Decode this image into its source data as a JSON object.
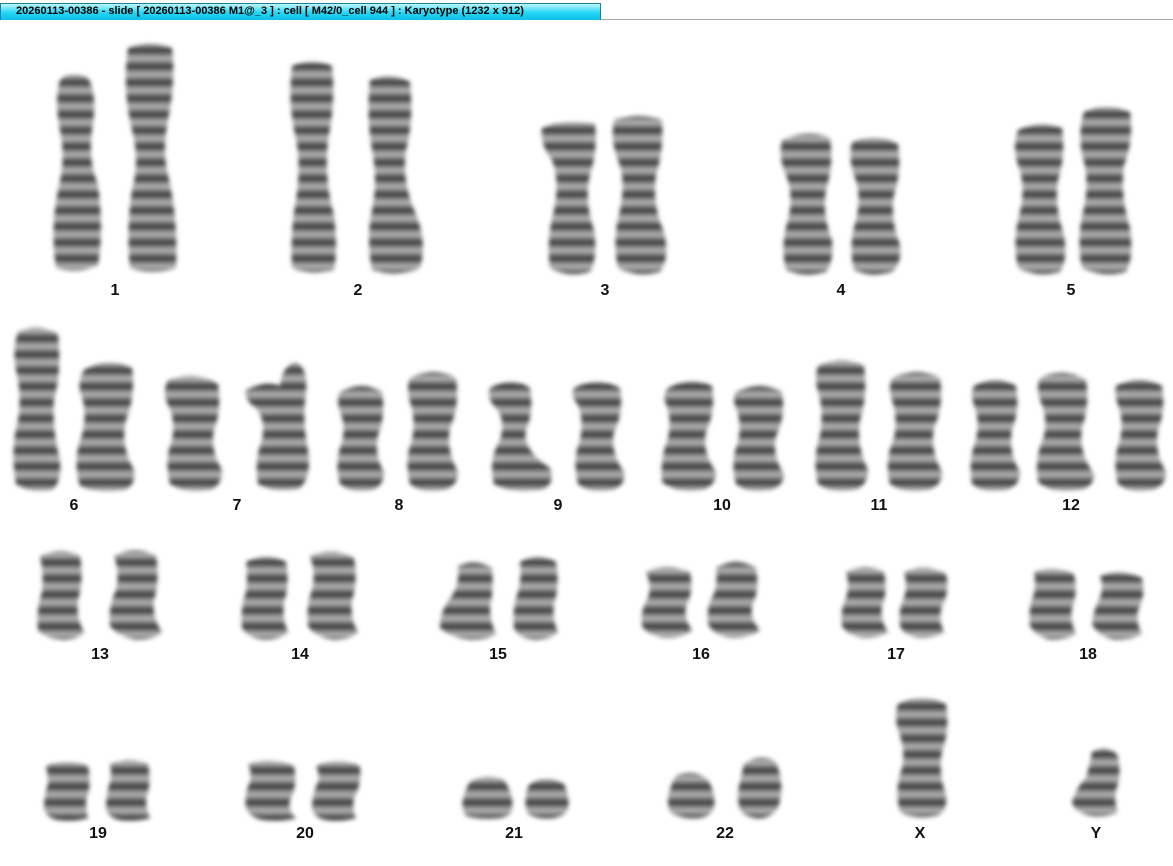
{
  "window": {
    "title": "20260113-00386 - slide [ 20260113-00386 M1@_3 ] : cell [ M42/0_cell 944 ] : Karyotype  (1232 x 912)"
  },
  "karyotype": {
    "labels": [
      "1",
      "2",
      "3",
      "4",
      "5",
      "6",
      "7",
      "8",
      "9",
      "10",
      "11",
      "12",
      "13",
      "14",
      "15",
      "16",
      "17",
      "18",
      "19",
      "20",
      "21",
      "22",
      "X",
      "Y"
    ]
  }
}
